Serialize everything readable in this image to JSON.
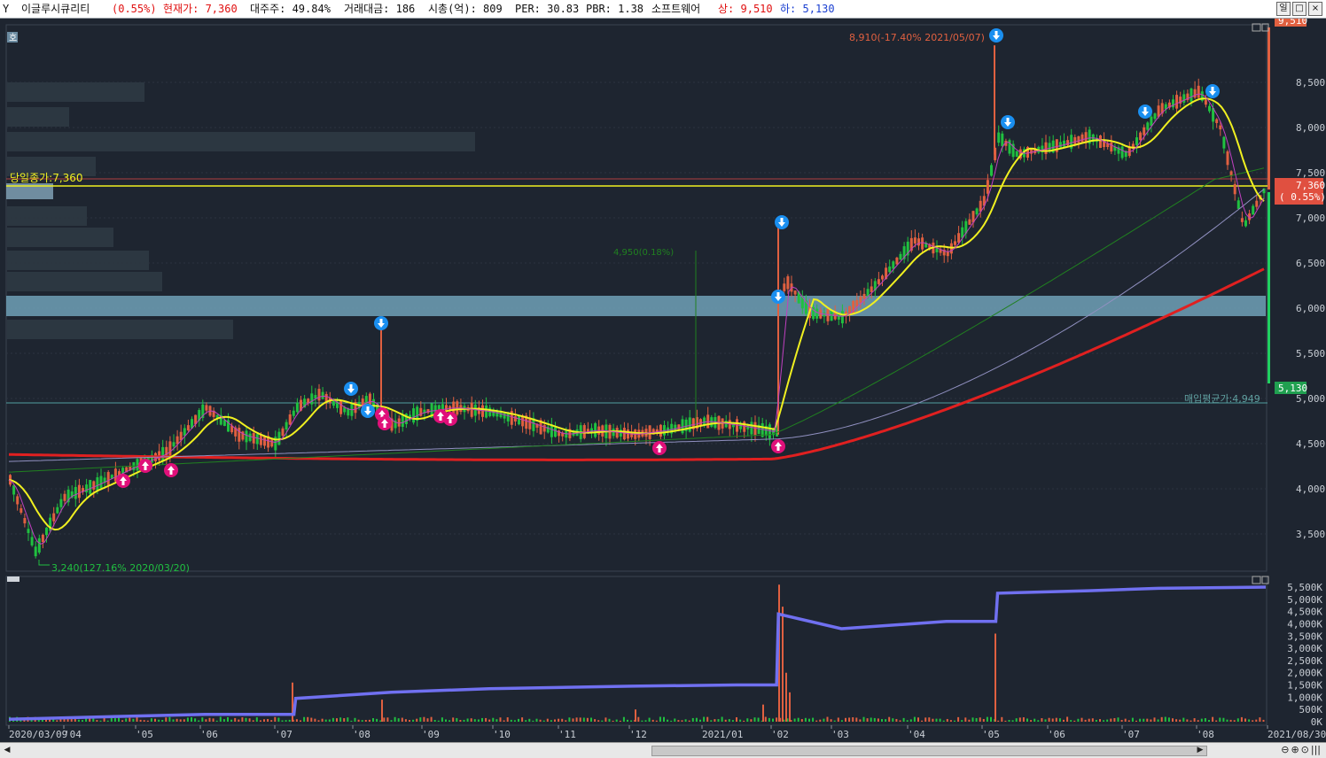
{
  "titlebar": {
    "stock_name": "이글루시큐리티",
    "change_pct": "(0.55%)",
    "price_label": "현재가: 7,360",
    "major_holder": "대주주: 49.84%",
    "trade_amount": "거래대금: 186",
    "market_cap": "시총(억): 809",
    "per": "PER: 30.83",
    "pbr": "PBR: 1.38",
    "sector": "소프트웨어",
    "upper": "상: 9,510",
    "lower": "하: 5,130",
    "period_btn": "일",
    "max_btn": "□",
    "close_btn": "×",
    "menu_icon": "Y"
  },
  "price_chart": {
    "corner_label": "호",
    "prev_close_label": "당일종가:7,360",
    "avg_buy_label": "매입평균가:4,949",
    "high_annotation": "8,910(-17.40% 2021/05/07)",
    "low_annotation": "3,240(127.16% 2020/03/20)",
    "upper_limit_tag": "9,510",
    "lower_limit_tag": "5,130",
    "current_tag_price": "7,360",
    "current_tag_pct": "( 0.55%)",
    "hidden_annotation": "4,950(0.18%)",
    "y_ticks": [
      "8,500",
      "8,000",
      "7,500",
      "7,000",
      "6,500",
      "6,000",
      "5,500",
      "5,000",
      "4,500",
      "4,000",
      "3,500"
    ]
  },
  "volume_chart": {
    "y_ticks": [
      "5,500K",
      "5,000K",
      "4,500K",
      "4,000K",
      "3,500K",
      "3,000K",
      "2,500K",
      "2,000K",
      "1,500K",
      "1,000K",
      "500K",
      "0K"
    ]
  },
  "x_axis": {
    "labels": [
      "2020/03/09",
      "'04",
      "'05",
      "'06",
      "'07",
      "'08",
      "'09",
      "'10",
      "'11",
      "'12",
      "2021/01",
      "'02",
      "'03",
      "'04",
      "'05",
      "'06",
      "'07",
      "'08",
      "2021/08/30"
    ]
  },
  "scrollbar": {
    "left_arrow": "◀",
    "right_arrow": "▶",
    "zoom_out": "⊖",
    "zoom_in": "⊕",
    "reset": "⊙",
    "bars": "|||"
  },
  "colors": {
    "background": "#1e2530",
    "up_candle": "#e06040",
    "down_candle": "#20c040",
    "ma5": "#c040c0",
    "ma20": "#f0f020",
    "ma60": "#208020",
    "ma120": "#9090c0",
    "ma240": "#e02020",
    "obv_line": "#7070f0",
    "band": "#6a9ab0",
    "buy_marker": "#e0107a",
    "sell_marker": "#1a8ff0"
  },
  "chart_data": {
    "type": "line",
    "title": "",
    "x_range": [
      "2020/03/09",
      "2021/08/30"
    ],
    "ylim_price": [
      3200,
      9510
    ],
    "series": [
      {
        "name": "close",
        "x": [
          "2020/03/09",
          "2020/03/20",
          "2020/04/01",
          "2020/04/15",
          "2020/05/01",
          "2020/05/15",
          "2020/06/01",
          "2020/06/15",
          "2020/07/01",
          "2020/07/10",
          "2020/07/20",
          "2020/08/01",
          "2020/08/10",
          "2020/08/20",
          "2020/09/01",
          "2020/09/15",
          "2020/10/01",
          "2020/10/15",
          "2020/11/01",
          "2020/11/15",
          "2020/12/01",
          "2020/12/15",
          "2021/01/01",
          "2021/01/15",
          "2021/02/01",
          "2021/02/02",
          "2021/02/05",
          "2021/02/15",
          "2021/03/01",
          "2021/03/15",
          "2021/04/01",
          "2021/04/15",
          "2021/05/01",
          "2021/05/07",
          "2021/05/15",
          "2021/06/01",
          "2021/06/15",
          "2021/07/01",
          "2021/07/15",
          "2021/08/01",
          "2021/08/10",
          "2021/08/20",
          "2021/08/30"
        ],
        "values": [
          4100,
          3300,
          3900,
          4050,
          4250,
          4400,
          4900,
          4600,
          4500,
          4900,
          5050,
          4850,
          5000,
          4700,
          4850,
          4900,
          4850,
          4750,
          4600,
          4650,
          4600,
          4650,
          4750,
          4700,
          4620,
          6100,
          6300,
          5950,
          5900,
          6250,
          6750,
          6600,
          7200,
          7900,
          7700,
          7800,
          7900,
          7700,
          8200,
          8400,
          8000,
          6900,
          7360
        ]
      },
      {
        "name": "volume_obv",
        "x": [
          "2020/03/09",
          "2020/06/01",
          "2020/07/10",
          "2020/08/20",
          "2020/10/01",
          "2020/12/01",
          "2021/01/15",
          "2021/02/02",
          "2021/03/01",
          "2021/04/15",
          "2021/05/07",
          "2021/06/15",
          "2021/07/15",
          "2021/08/30"
        ],
        "values": [
          100,
          300,
          950,
          1200,
          1350,
          1450,
          1500,
          4400,
          3800,
          4100,
          5250,
          5350,
          5450,
          5500
        ]
      }
    ]
  }
}
